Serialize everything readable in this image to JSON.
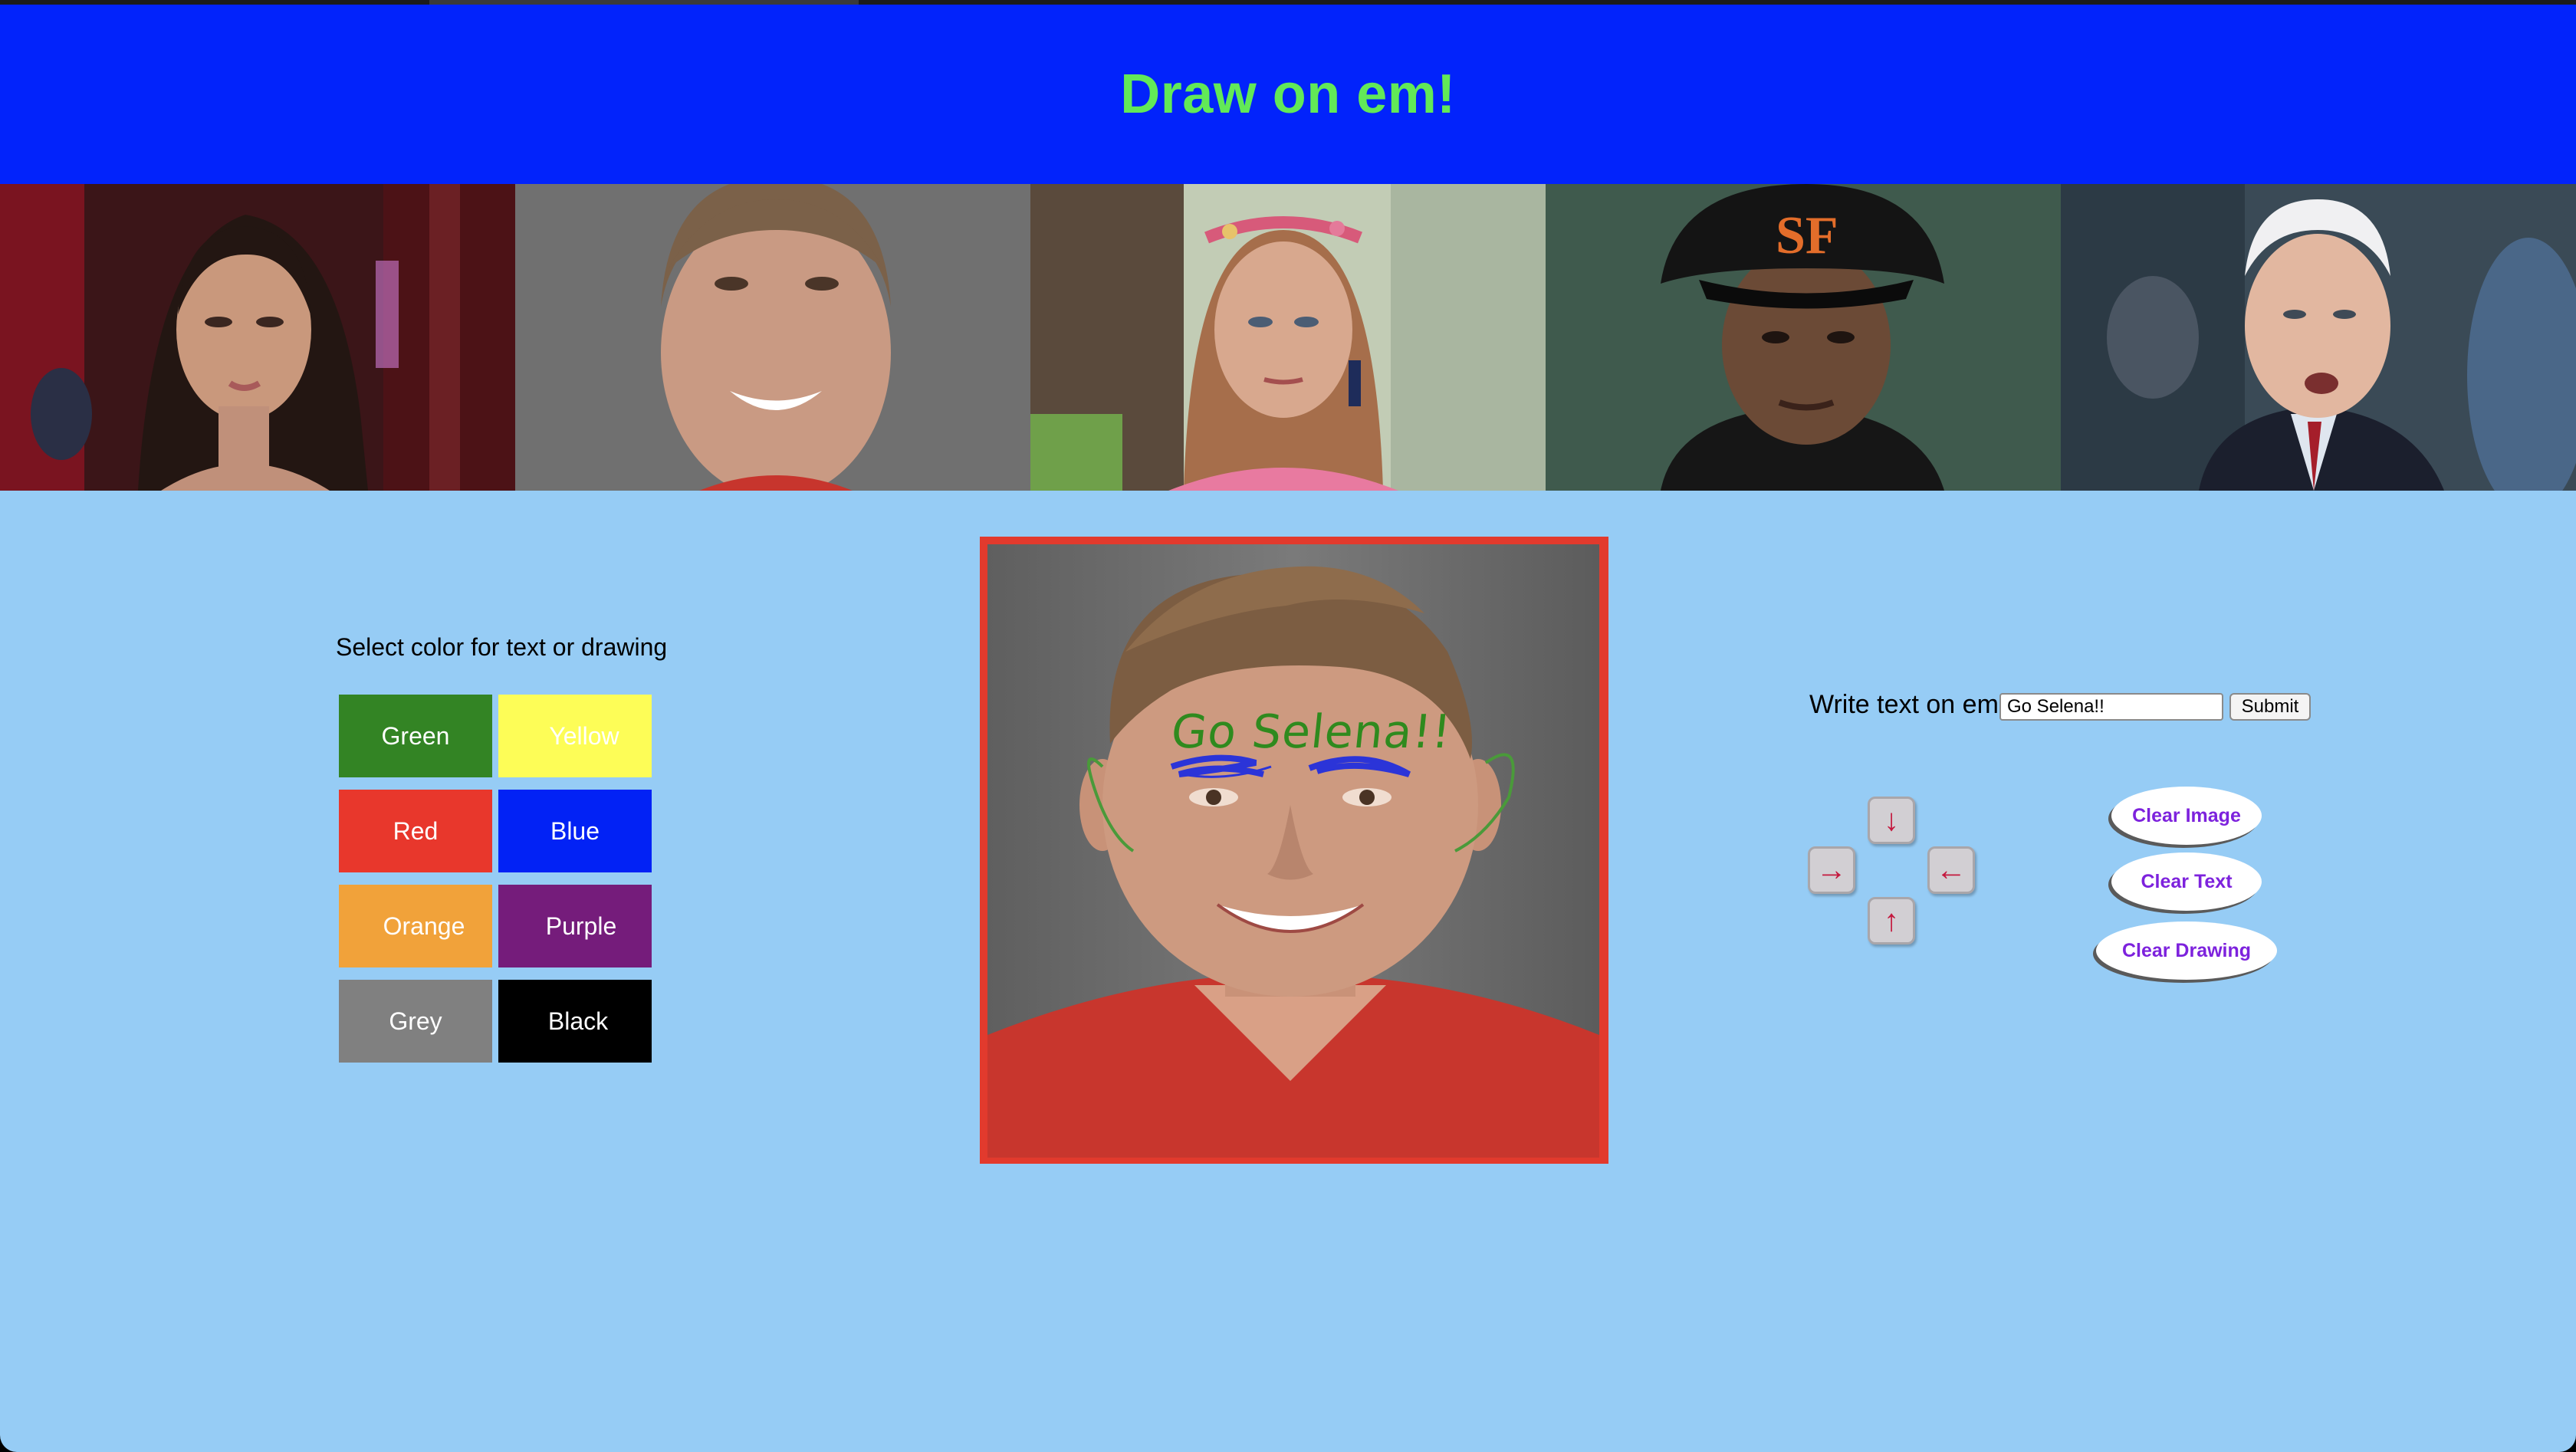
{
  "header": {
    "title": "Draw on em!",
    "title_color": "#62e957",
    "background": "#0223fb"
  },
  "gallery": {
    "items": [
      {
        "name": "thumb-1",
        "bg": "#5a1a1c"
      },
      {
        "name": "thumb-2",
        "bg": "#6f6f6f"
      },
      {
        "name": "thumb-3",
        "bg": "#b9c6a3"
      },
      {
        "name": "thumb-4",
        "bg": "#3e5a4c"
      },
      {
        "name": "thumb-5",
        "bg": "#3a4a55"
      }
    ]
  },
  "palette": {
    "title": "Select color for text or drawing",
    "swatches": [
      {
        "label": "Green",
        "color": "#338424"
      },
      {
        "label": "Yellow",
        "color": "#fdfd57"
      },
      {
        "label": "Red",
        "color": "#e8372c"
      },
      {
        "label": "Blue",
        "color": "#0222f5"
      },
      {
        "label": "Orange",
        "color": "#f1a23a"
      },
      {
        "label": "Purple",
        "color": "#751c7b"
      },
      {
        "label": "Grey",
        "color": "#808080"
      },
      {
        "label": "Black",
        "color": "#000000"
      }
    ]
  },
  "canvas": {
    "overlay_text": "Go Selena!!",
    "overlay_text_color": "#2f8a1e",
    "border_color": "#e23a2d"
  },
  "controls": {
    "write_label": "Write text on em!",
    "input_value": "Go Selena!!",
    "submit_label": "Submit",
    "arrows": {
      "down": "↓",
      "right": "→",
      "left": "←",
      "up": "↑"
    },
    "clear_image_label": "Clear Image",
    "clear_text_label": "Clear Text",
    "clear_drawing_label": "Clear Drawing"
  }
}
